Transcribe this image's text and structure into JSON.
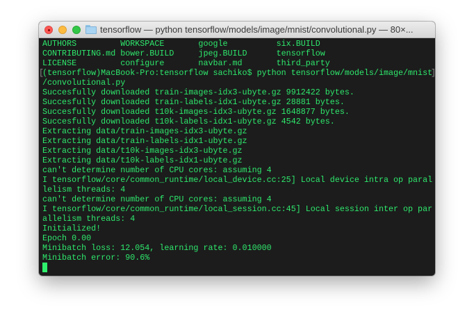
{
  "window": {
    "title": "tensorflow — python tensorflow/models/image/mnist/convolutional.py — 80×..."
  },
  "terminal": {
    "lines": [
      "AUTHORS         WORKSPACE       google          six.BUILD",
      "CONTRIBUTING.md bower.BUILD     jpeg.BUILD      tensorflow",
      "LICENSE         configure       navbar.md       third_party",
      "(tensorflow)MacBook-Pro:tensorflow sachiko$ python tensorflow/models/image/mnist",
      "/convolutional.py",
      "Succesfully downloaded train-images-idx3-ubyte.gz 9912422 bytes.",
      "Succesfully downloaded train-labels-idx1-ubyte.gz 28881 bytes.",
      "Succesfully downloaded t10k-images-idx3-ubyte.gz 1648877 bytes.",
      "Succesfully downloaded t10k-labels-idx1-ubyte.gz 4542 bytes.",
      "Extracting data/train-images-idx3-ubyte.gz",
      "Extracting data/train-labels-idx1-ubyte.gz",
      "Extracting data/t10k-images-idx3-ubyte.gz",
      "Extracting data/t10k-labels-idx1-ubyte.gz",
      "can't determine number of CPU cores: assuming 4",
      "I tensorflow/core/common_runtime/local_device.cc:25] Local device intra op paral",
      "lelism threads: 4",
      "can't determine number of CPU cores: assuming 4",
      "I tensorflow/core/common_runtime/local_session.cc:45] Local session inter op par",
      "allelism threads: 4",
      "Initialized!",
      "Epoch 0.00",
      "Minibatch loss: 12.054, learning rate: 0.010000",
      "Minibatch error: 90.6%"
    ],
    "prompt_line_index": 3,
    "text_color": "#2ee86c",
    "background": "#1c1c1c"
  }
}
